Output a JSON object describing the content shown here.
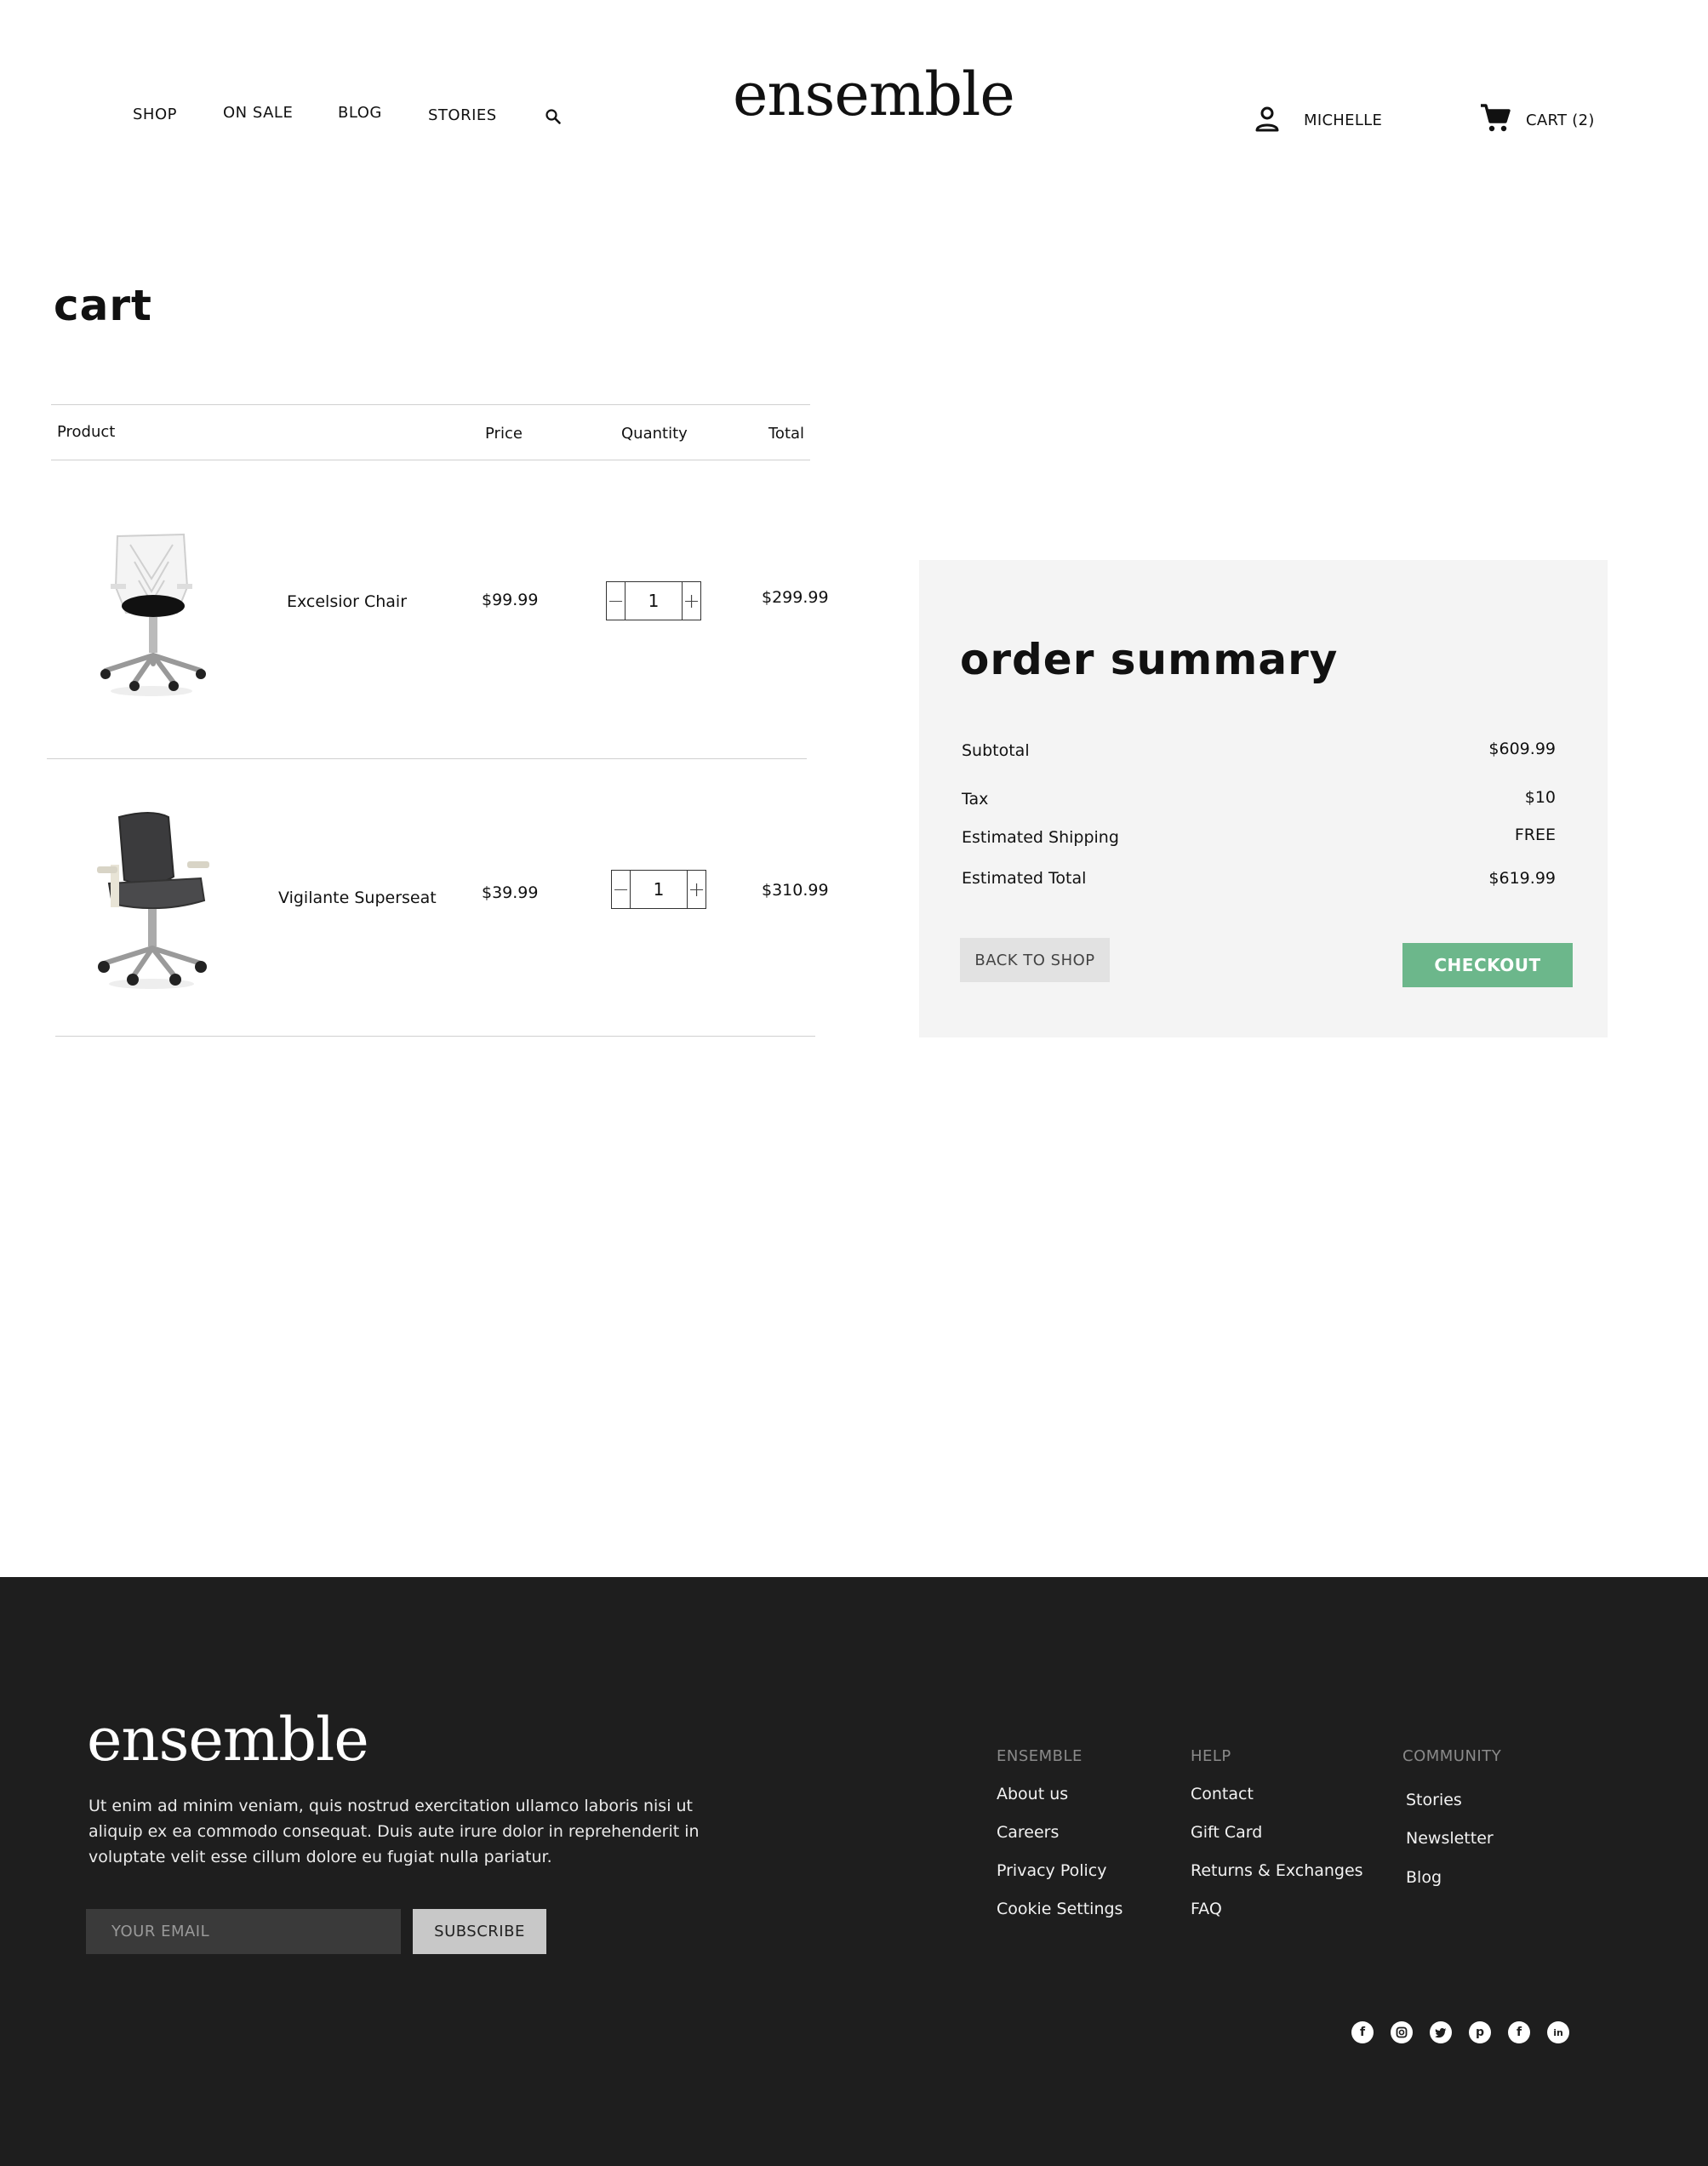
{
  "header": {
    "nav": [
      "SHOP",
      "ON SALE",
      "BLOG",
      "STORIES"
    ],
    "logo": "ensemble",
    "user_name": "MICHELLE",
    "cart_label": "CART (2)"
  },
  "cart": {
    "title": "cart",
    "columns": [
      "Product",
      "Price",
      "Quantity",
      "Total"
    ],
    "items": [
      {
        "name": "Excelsior Chair",
        "price": "$99.99",
        "quantity": "1",
        "total": "$299.99",
        "image": "white-office-chair"
      },
      {
        "name": "Vigilante Superseat",
        "price": "$39.99",
        "quantity": "1",
        "total": "$310.99",
        "image": "dark-office-chair"
      }
    ],
    "qty_minus": "−",
    "qty_plus": "+"
  },
  "summary": {
    "title": "order summary",
    "rows": [
      {
        "label": "Subtotal",
        "value": "$609.99"
      },
      {
        "label": "Tax",
        "value": "$10"
      },
      {
        "label": "Estimated Shipping",
        "value": "FREE"
      },
      {
        "label": "Estimated Total",
        "value": "$619.99"
      }
    ],
    "back_label": "BACK TO SHOP",
    "checkout_label": "CHECKOUT",
    "checkout_color": "#6cb78b"
  },
  "footer": {
    "logo": "ensemble",
    "text": "Ut enim ad minim veniam, quis nostrud exercitation ullamco laboris nisi ut aliquip ex ea commodo consequat. Duis aute irure dolor in reprehenderit in voluptate velit esse cillum dolore eu fugiat nulla pariatur.",
    "email_placeholder": "YOUR EMAIL",
    "subscribe_label": "SUBSCRIBE",
    "columns": [
      {
        "heading": "ENSEMBLE",
        "links": [
          "About us",
          "Careers",
          "Privacy Policy",
          "Cookie Settings"
        ]
      },
      {
        "heading": "HELP",
        "links": [
          "Contact",
          "Gift Card",
          "Returns & Exchanges",
          "FAQ"
        ]
      },
      {
        "heading": "COMMUNITY",
        "links": [
          "Stories",
          "Newsletter",
          "Blog"
        ]
      }
    ],
    "social_icons": [
      "facebook-icon",
      "instagram-icon",
      "twitter-icon",
      "pinterest-icon",
      "facebook-icon",
      "linkedin-icon"
    ]
  }
}
